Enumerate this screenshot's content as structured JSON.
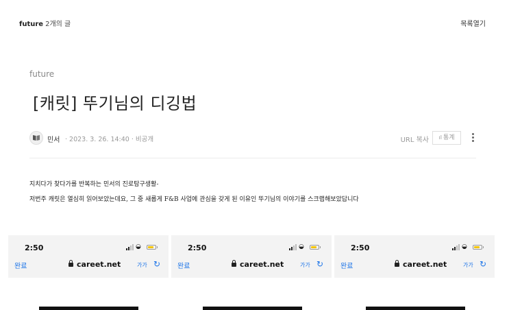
{
  "header": {
    "blog_name": "future",
    "post_count": "2개의 글",
    "list_toggle": "목록열기"
  },
  "post": {
    "category": "future",
    "title": "[캐릿] 뚜기님의 디깅법",
    "author": "민서",
    "date_visibility": "· 2023. 3. 26. 14:40 · 비공개",
    "url_copy": "URL 복사",
    "stats": "통계",
    "paragraphs": [
      "지치다가 찾다가를 반복하는 민서의 진로탐구생활-",
      "저번주 캐릿은 열심히 읽어보았는데요, 그 중 새롭게 F&B 사업에 관심을 갖게 된 이유인 뚜기님의 이야기를 스크랩해보았답니다"
    ]
  },
  "screenshots": [
    {
      "time": "2:50",
      "done": "완료",
      "url": "careet.net",
      "text_size": "가가",
      "reload": "↻"
    },
    {
      "time": "2:50",
      "done": "완료",
      "url": "careet.net",
      "text_size": "가가",
      "reload": "↻"
    },
    {
      "time": "2:50",
      "done": "완료",
      "url": "careet.net",
      "text_size": "가가",
      "reload": "↻"
    }
  ],
  "colors": {
    "accent_blue": "#1a73e8",
    "battery_yellow": "#f4c400"
  }
}
